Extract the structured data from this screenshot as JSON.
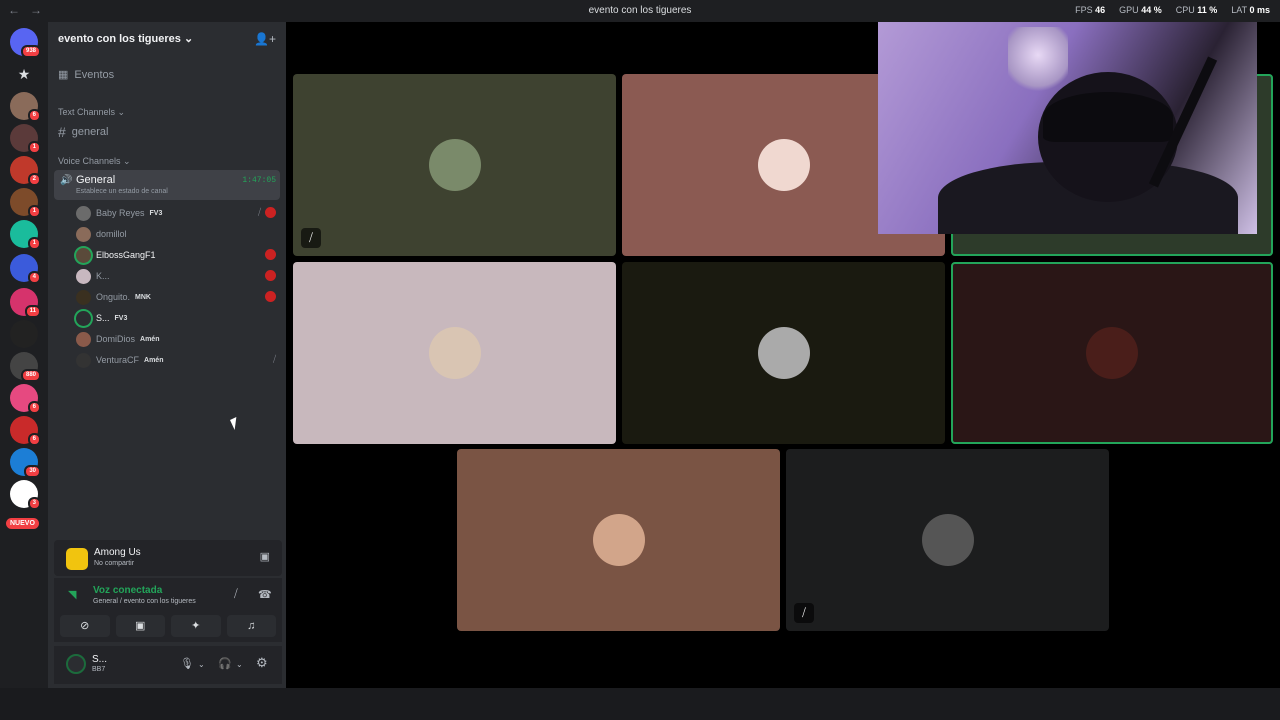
{
  "window": {
    "title": "evento con los tigueres",
    "stats": {
      "fps_label": "FPS",
      "fps": "46",
      "gpu_label": "GPU",
      "gpu": "44 %",
      "cpu_label": "CPU",
      "cpu": "11 %",
      "lat_label": "LAT",
      "lat": "0 ms"
    }
  },
  "servers": {
    "dm_badge": "938",
    "items": [
      {
        "badge": "6",
        "color": "#8a6b5a"
      },
      {
        "badge": "1",
        "color": "#5b3a3a"
      },
      {
        "badge": "2",
        "color": "#c0392b"
      },
      {
        "badge": "1",
        "color": "#7d4b2a"
      },
      {
        "badge": "1",
        "color": "#1abc9c"
      },
      {
        "badge": "4",
        "color": "#3b5bdb"
      },
      {
        "badge": "11",
        "color": "#d6336c"
      },
      {
        "badge": "",
        "color": "#222"
      },
      {
        "badge": "880",
        "color": "#444"
      },
      {
        "badge": "6",
        "color": "#e64980"
      },
      {
        "badge": "6",
        "color": "#c92a2a"
      },
      {
        "badge": "30",
        "color": "#1c7ed6"
      },
      {
        "badge": "3",
        "color": "#fff"
      }
    ],
    "new_label": "NUEVO"
  },
  "guild": {
    "name": "evento con los tigueres",
    "events_label": "Eventos",
    "text_category": "Text Channels",
    "text_channel": "general",
    "voice_category": "Voice Channels",
    "voice_channel": {
      "name": "General",
      "status": "Establece un estado de canal",
      "timer": "1:47:05"
    },
    "members": [
      {
        "name": "Baby Reyes",
        "tag": "FV3",
        "bright": false,
        "speaking": false,
        "color": "#6b6b6b"
      },
      {
        "name": "domillol",
        "tag": "",
        "bright": false,
        "speaking": false,
        "color": "#8a6b5a"
      },
      {
        "name": "ElbossGangF1",
        "tag": "",
        "bright": true,
        "speaking": true,
        "color": "#5a4a3a"
      },
      {
        "name": "K...",
        "tag": "",
        "bright": false,
        "speaking": false,
        "color": "#c8b8c0"
      },
      {
        "name": "Onguito.",
        "tag": "MNK",
        "bright": false,
        "speaking": false,
        "color": "#3a3020"
      },
      {
        "name": "S...",
        "tag": "FV3",
        "bright": true,
        "speaking": true,
        "color": "#2b2d31"
      },
      {
        "name": "DomiDios",
        "tag": "Amén",
        "bright": false,
        "speaking": false,
        "color": "#8a5a4a"
      },
      {
        "name": "VenturaCF",
        "tag": "Amén",
        "bright": false,
        "speaking": false,
        "color": "#333"
      }
    ]
  },
  "activity": {
    "name": "Among Us",
    "sub": "No compartir"
  },
  "rtc": {
    "state": "Voz conectada",
    "location": "General / evento con los tigueres"
  },
  "user": {
    "name": "S...",
    "sub": "BB7"
  },
  "tiles": [
    {
      "bg": "#3e4230",
      "pic": "#7a8a6a",
      "muted": true,
      "speaking": false
    },
    {
      "bg": "#8b5a52",
      "pic": "#f0d8d0",
      "muted": false,
      "speaking": false
    },
    {
      "bg": "#2d3b2a",
      "pic": "#555",
      "muted": false,
      "speaking": true
    },
    {
      "bg": "#c8b8bd",
      "pic": "#d9c5b3",
      "muted": false,
      "speaking": false
    },
    {
      "bg": "#1a1a10",
      "pic": "#aaa",
      "muted": false,
      "speaking": false
    },
    {
      "bg": "#2a1616",
      "pic": "#4a1e1a",
      "muted": false,
      "speaking": true
    },
    {
      "bg": "#7a5444",
      "pic": "#d2a58a",
      "muted": false,
      "speaking": false
    },
    {
      "bg": "#1c1d1e",
      "pic": "#555",
      "muted": true,
      "speaking": false
    }
  ]
}
